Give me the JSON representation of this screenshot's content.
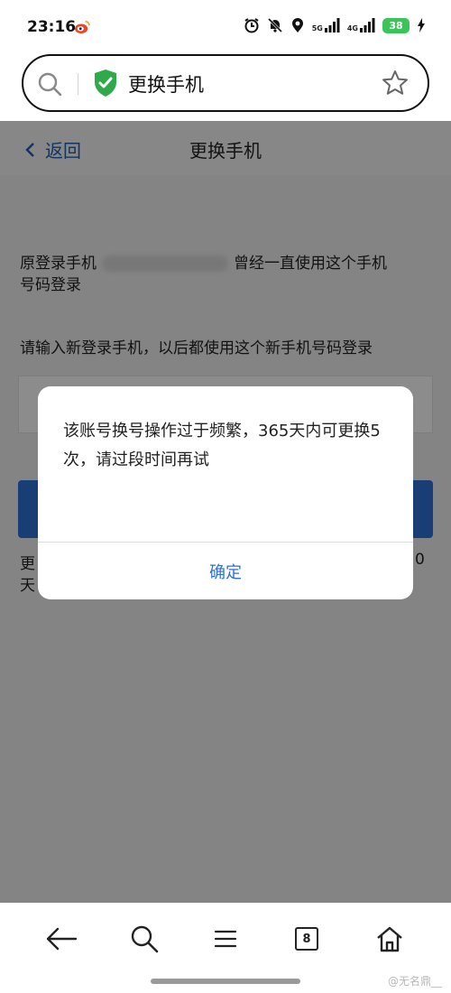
{
  "status_bar": {
    "time": "23:16",
    "net_5g": "5G",
    "net_4g": "4G",
    "battery": "38"
  },
  "address_bar": {
    "title": "更换手机"
  },
  "header": {
    "back_label": "返回",
    "title": "更换手机"
  },
  "body": {
    "original_phone_prefix": "原登录手机",
    "original_phone_suffix": "曾经一直使用这个手机",
    "original_phone_line2": "号码登录",
    "new_phone_prompt": "请输入新登录手机，以后都使用这个新手机号码登录",
    "note_line1_start": "更",
    "note_line1_end": "0",
    "note_line2_start": "天"
  },
  "dialog": {
    "message": "该账号换号操作过于频繁，365天内可更换5次，请过段时间再试",
    "ok_label": "确定"
  },
  "bottom_nav": {
    "tab_count": "8"
  },
  "watermark": "@无名鼎__",
  "colors": {
    "accent": "#2f6fd6",
    "link": "#1f5fb4",
    "shield": "#2eaa4a",
    "battery": "#3cc35a"
  }
}
